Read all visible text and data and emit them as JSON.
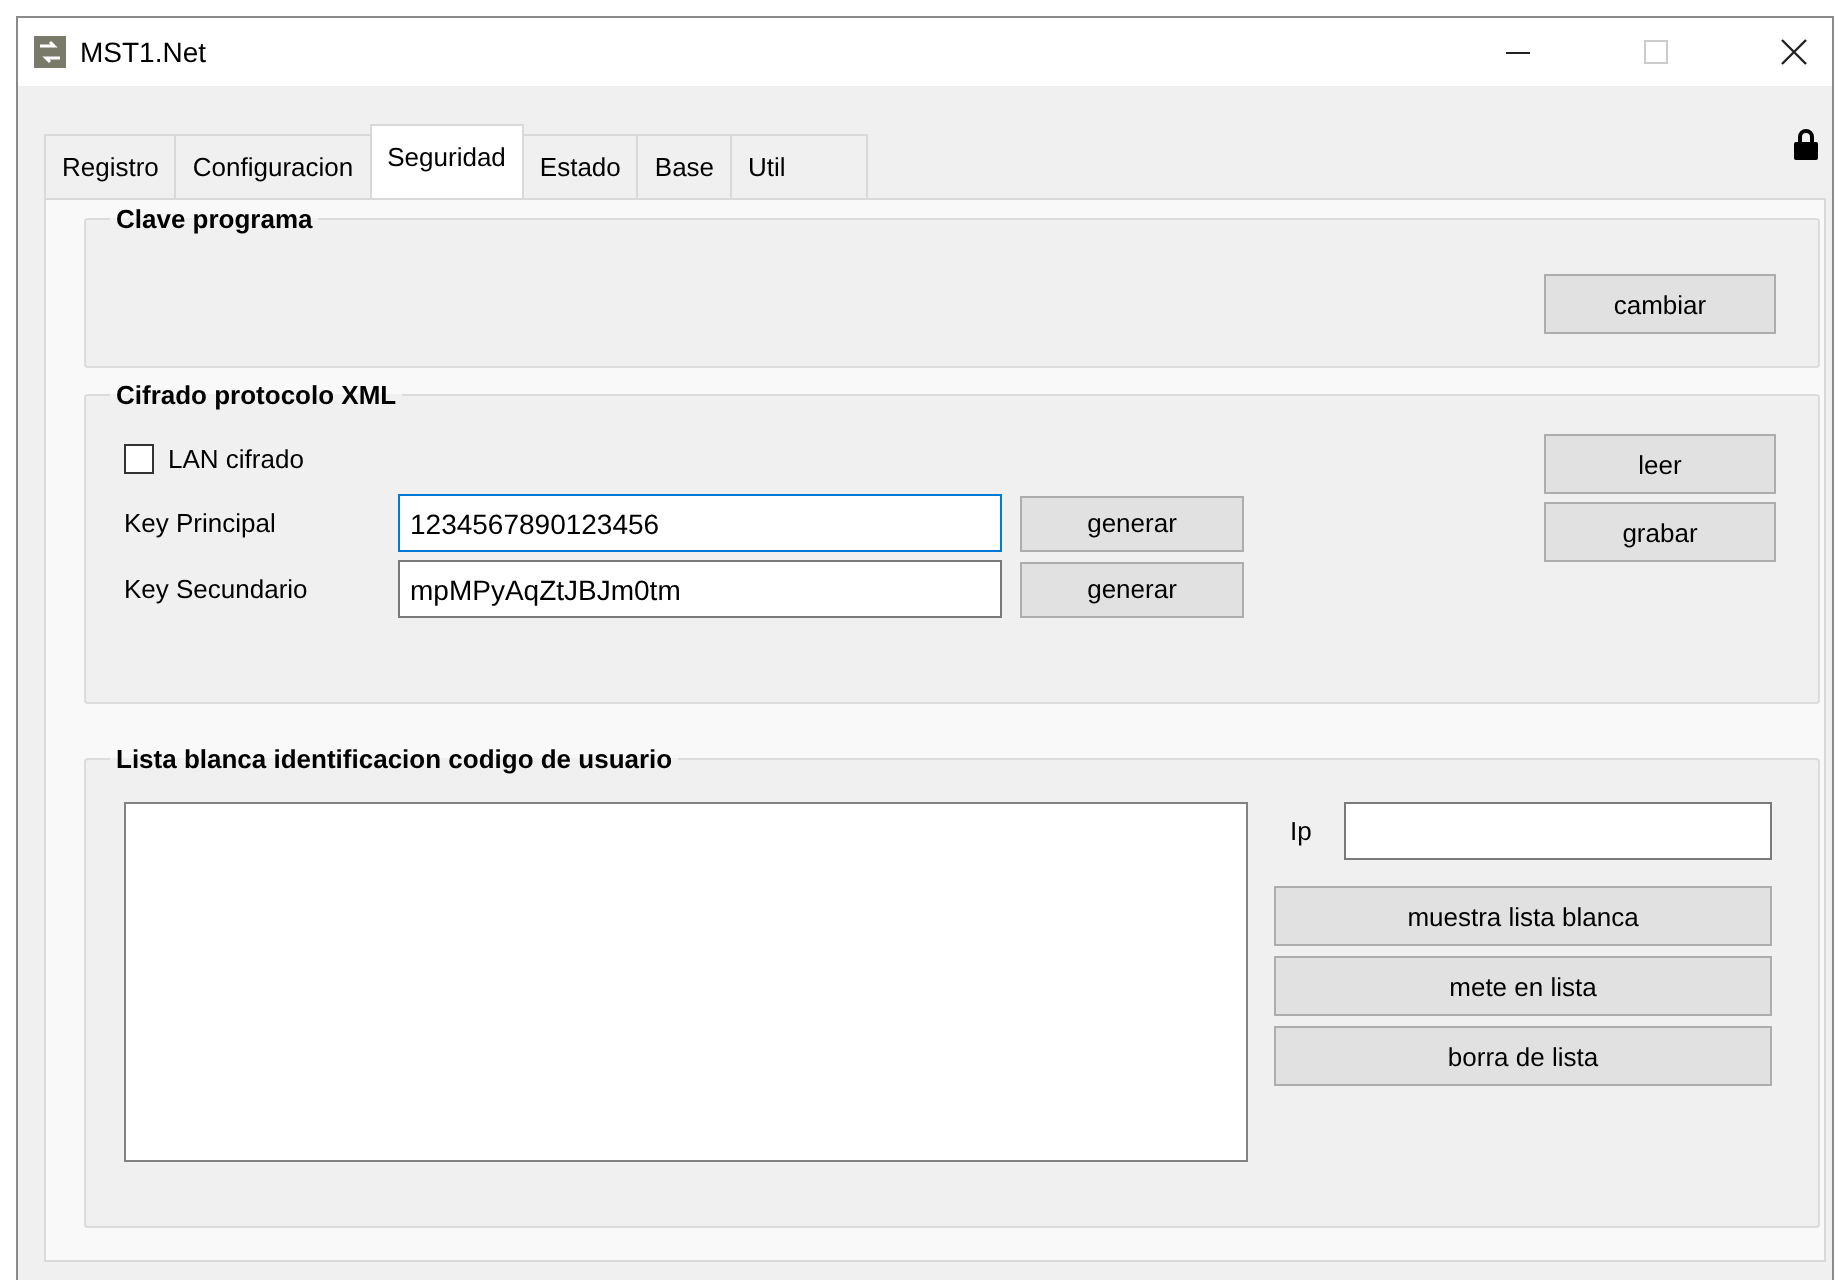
{
  "window": {
    "title": "MST1.Net"
  },
  "tabs": [
    {
      "label": "Registro",
      "selected": false
    },
    {
      "label": "Configuracion",
      "selected": false
    },
    {
      "label": "Seguridad",
      "selected": true
    },
    {
      "label": "Estado",
      "selected": false
    },
    {
      "label": "Base",
      "selected": false
    },
    {
      "label": "Util",
      "selected": false
    }
  ],
  "clave_programa": {
    "title": "Clave programa",
    "button": "cambiar"
  },
  "cifrado": {
    "title": "Cifrado protocolo XML",
    "lan_cifrado": {
      "label": "LAN cifrado",
      "checked": false
    },
    "key_principal": {
      "label": "Key Principal",
      "value": "1234567890123456",
      "button": "generar"
    },
    "key_secundario": {
      "label": "Key Secundario",
      "value": "mpMPyAqZtJBJm0tm",
      "button": "generar"
    },
    "buttons": [
      "leer",
      "grabar"
    ]
  },
  "lista_blanca": {
    "title": "Lista blanca identificacion codigo de usuario",
    "ip_label": "Ip",
    "buttons": [
      "muestra lista blanca",
      "mete en lista",
      "borra de lista"
    ]
  }
}
